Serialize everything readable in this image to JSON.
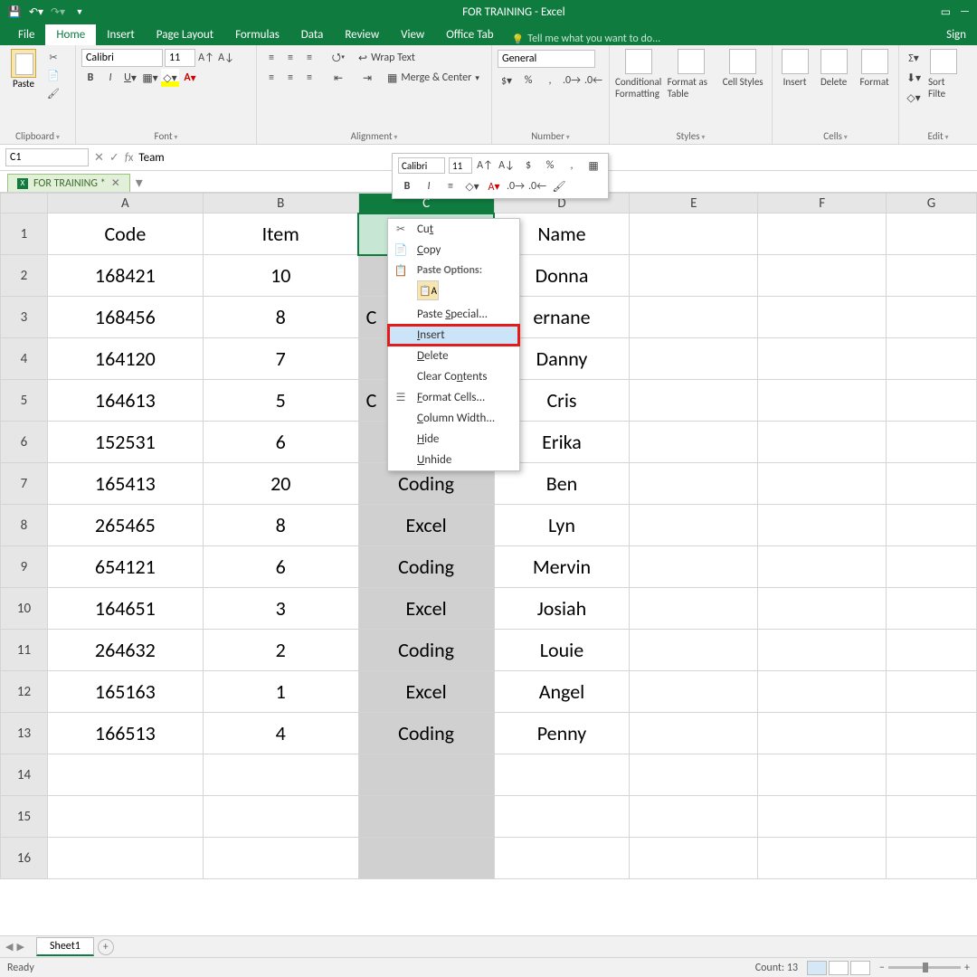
{
  "titlebar": {
    "title": "FOR TRAINING - Excel"
  },
  "menus": {
    "file": "File",
    "home": "Home",
    "insert": "Insert",
    "page_layout": "Page Layout",
    "formulas": "Formulas",
    "data": "Data",
    "review": "Review",
    "view": "View",
    "office_tab": "Office Tab",
    "tell_me": "Tell me what you want to do...",
    "sign": "Sign"
  },
  "ribbon": {
    "clipboard": {
      "label": "Clipboard",
      "paste": "Paste"
    },
    "font": {
      "label": "Font",
      "name": "Calibri",
      "size": "11"
    },
    "alignment": {
      "label": "Alignment",
      "wrap": "Wrap Text",
      "merge": "Merge & Center"
    },
    "number": {
      "label": "Number",
      "format": "General"
    },
    "styles": {
      "label": "Styles",
      "cond": "Conditional Formatting",
      "table": "Format as Table",
      "cell": "Cell Styles"
    },
    "cells": {
      "label": "Cells",
      "insert": "Insert",
      "delete": "Delete",
      "format": "Format"
    },
    "editing": {
      "label": "Edit",
      "sort": "Sort Filte"
    }
  },
  "formula_bar": {
    "cell_ref": "C1",
    "formula": "Team"
  },
  "booktab": {
    "name": "FOR TRAINING *"
  },
  "mini_toolbar": {
    "font": "Calibri",
    "size": "11"
  },
  "context_menu": {
    "cut": "Cut",
    "copy": "Copy",
    "paste_options": "Paste Options:",
    "paste_special": "Paste Special...",
    "insert": "Insert",
    "delete": "Delete",
    "clear": "Clear Contents",
    "format_cells": "Format Cells...",
    "col_width": "Column Width...",
    "hide": "Hide",
    "unhide": "Unhide"
  },
  "columns": [
    "A",
    "B",
    "C",
    "D",
    "E",
    "F",
    "G"
  ],
  "headers": {
    "A": "Code",
    "B": "Item",
    "C": "",
    "D": "Name"
  },
  "partial_c": {
    "3": "C",
    "5": "C"
  },
  "rows": [
    {
      "A": "168421",
      "B": "10",
      "C": "",
      "D": "Donna"
    },
    {
      "A": "168456",
      "B": "8",
      "C": "",
      "D": "ernane"
    },
    {
      "A": "164120",
      "B": "7",
      "C": "",
      "D": "Danny"
    },
    {
      "A": "164613",
      "B": "5",
      "C": "",
      "D": "Cris"
    },
    {
      "A": "152531",
      "B": "6",
      "C": "",
      "D": "Erika"
    },
    {
      "A": "165413",
      "B": "20",
      "C": "Coding",
      "D": "Ben"
    },
    {
      "A": "265465",
      "B": "8",
      "C": "Excel",
      "D": "Lyn"
    },
    {
      "A": "654121",
      "B": "6",
      "C": "Coding",
      "D": "Mervin"
    },
    {
      "A": "164651",
      "B": "3",
      "C": "Excel",
      "D": "Josiah"
    },
    {
      "A": "264632",
      "B": "2",
      "C": "Coding",
      "D": "Louie"
    },
    {
      "A": "165163",
      "B": "1",
      "C": "Excel",
      "D": "Angel"
    },
    {
      "A": "166513",
      "B": "4",
      "C": "Coding",
      "D": "Penny"
    }
  ],
  "sheet_tabs": {
    "sheet1": "Sheet1"
  },
  "status": {
    "ready": "Ready",
    "count": "Count: 13"
  }
}
